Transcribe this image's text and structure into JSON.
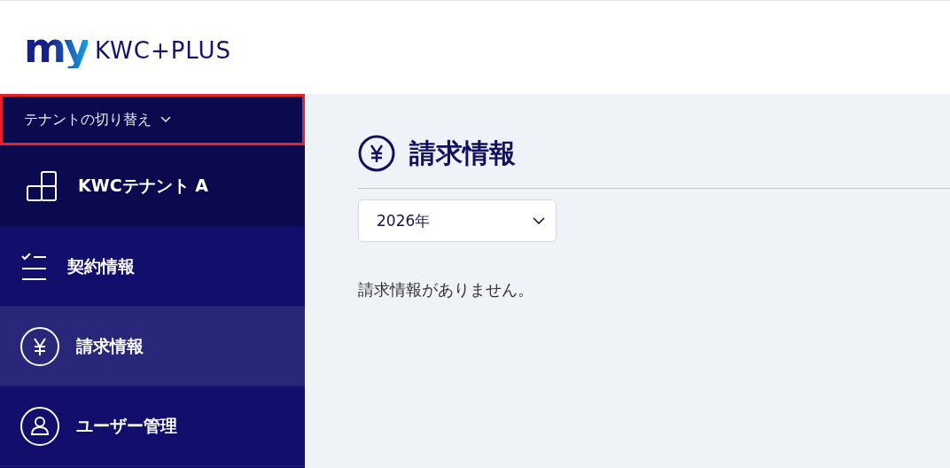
{
  "header": {
    "logo": {
      "mark": "my",
      "name": "KWC+PLUS"
    }
  },
  "sidebar": {
    "tenant_switch": {
      "label": "テナントの切り替え",
      "highlighted": true
    },
    "tenant": {
      "name": "KWCテナント A"
    },
    "items": [
      {
        "label": "契約情報",
        "kind": "checklist",
        "selected": false
      },
      {
        "label": "請求情報",
        "kind": "yen",
        "selected": true
      },
      {
        "label": "ユーザー管理",
        "kind": "user",
        "selected": false
      }
    ]
  },
  "main": {
    "title": "請求情報",
    "year_select": {
      "value": "2026年"
    },
    "message": "請求情報がありません。"
  }
}
